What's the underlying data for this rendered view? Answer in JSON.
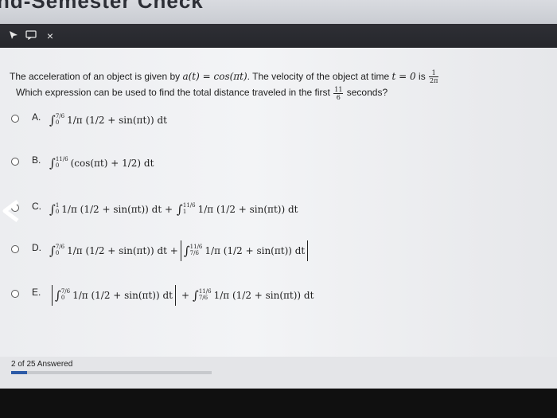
{
  "header": {
    "title": "nd-Semester Check"
  },
  "toolbar": {
    "icons": [
      "pointer-icon",
      "comment-icon",
      "close-icon"
    ],
    "close_glyph": "×"
  },
  "question": {
    "line1_pre": "The acceleration of an object is given by ",
    "line1_eq": "a(t) = cos(πt)",
    "line1_mid": ". The velocity of the object at time ",
    "line1_t0": "t = 0",
    "line1_is": " is ",
    "v0_num": "1",
    "v0_den": "2π",
    "line2_pre": "Which expression can be used to find the total distance traveled in the first ",
    "t_num": "11",
    "t_den": "6",
    "line2_post": " seconds?"
  },
  "options": [
    {
      "letter": "A.",
      "int1_upper": "7/6",
      "int1_lower": "0",
      "int1_body": "1/π (1/2 + sin(πt)) dt"
    },
    {
      "letter": "B.",
      "int1_upper": "11/6",
      "int1_lower": "0",
      "int1_body": "(cos(πt) + 1/2) dt"
    },
    {
      "letter": "C.",
      "int1_upper": "1",
      "int1_lower": "0",
      "int1_body": "1/π (1/2 + sin(πt)) dt +",
      "int2_upper": "11/6",
      "int2_lower": "1",
      "int2_body": "1/π (1/2 + sin(πt)) dt"
    },
    {
      "letter": "D.",
      "int1_upper": "7/6",
      "int1_lower": "0",
      "int1_body": "1/π (1/2 + sin(πt)) dt +",
      "int2_upper": "11/6",
      "int2_lower": "7/6",
      "int2_body": "1/π (1/2 + sin(πt)) dt"
    },
    {
      "letter": "E.",
      "int1_upper": "7/6",
      "int1_lower": "0",
      "int1_body": "1/π (1/2 + sin(πt)) dt",
      "plus": "+",
      "int2_upper": "11/6",
      "int2_lower": "7/6",
      "int2_body": "1/π (1/2 + sin(πt)) dt"
    }
  ],
  "footer": {
    "progress_label": "2 of 25 Answered",
    "answered": 2,
    "total": 25,
    "progress_color": "#2c5aa7"
  }
}
